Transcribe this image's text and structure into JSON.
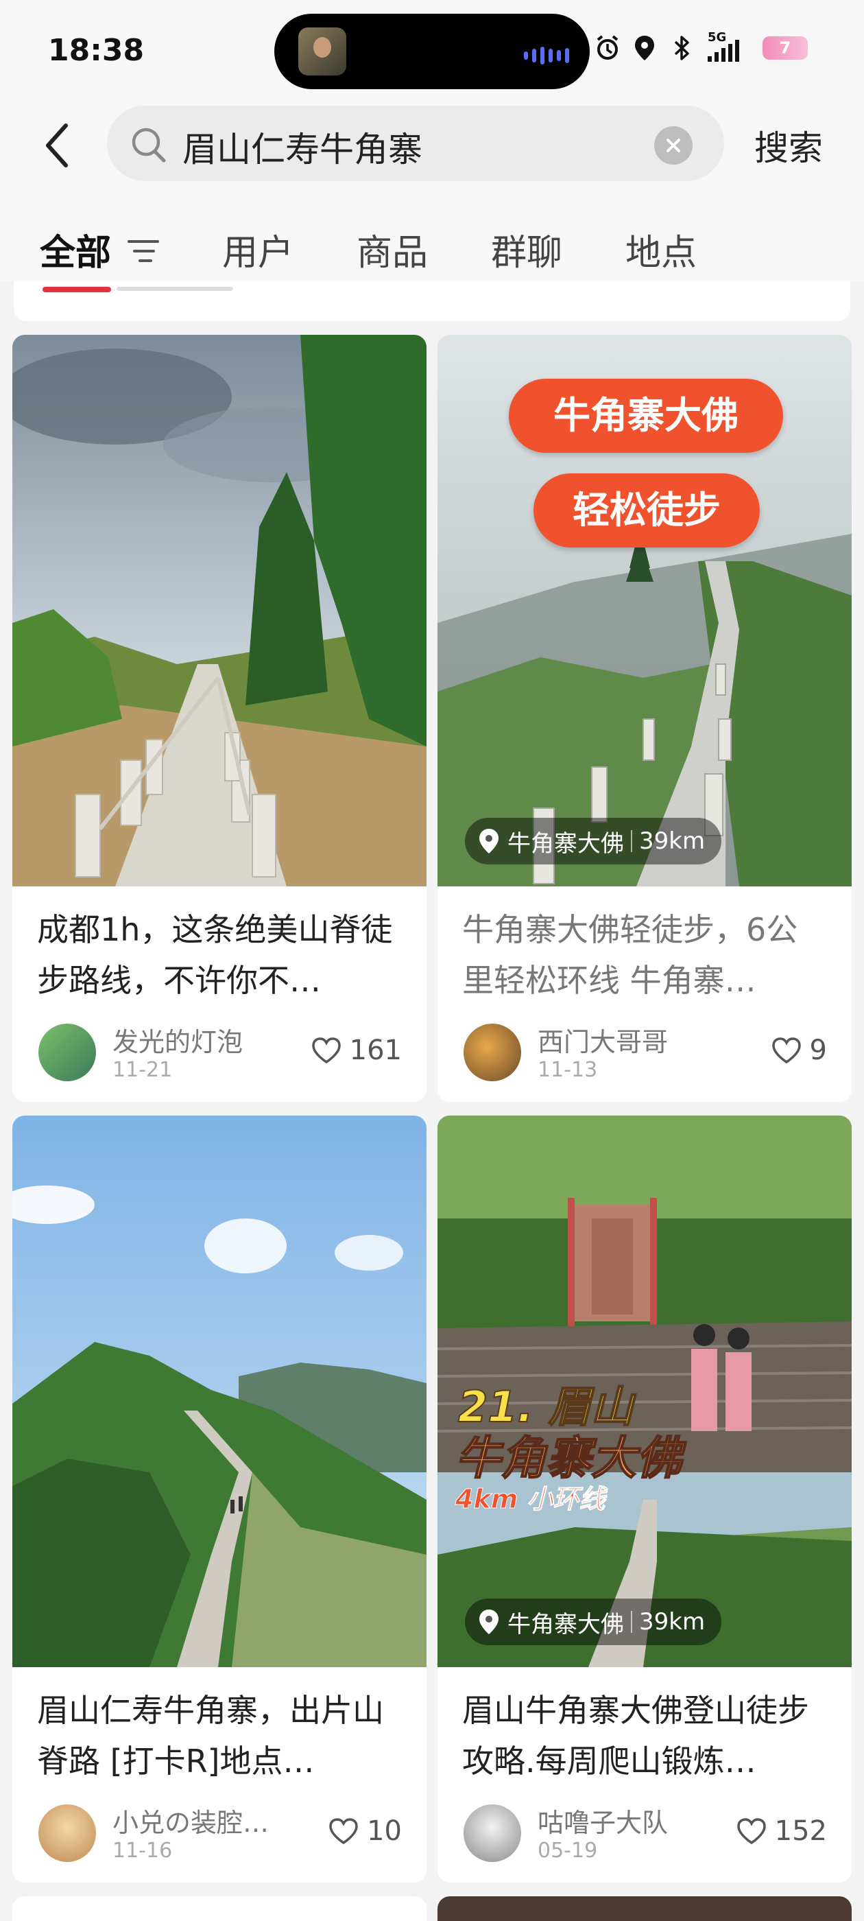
{
  "status_bar": {
    "time": "18:38",
    "network": "5G",
    "battery": "7"
  },
  "search": {
    "query": "眉山仁寿牛角寨",
    "button": "搜索"
  },
  "tabs": [
    "全部",
    "用户",
    "商品",
    "群聊",
    "地点"
  ],
  "cards": [
    {
      "title": "成都1h，这条绝美山脊徒步路线，不许你不…",
      "author": "发光的灯泡",
      "date": "11-21",
      "likes": "161",
      "location": "",
      "distance": "",
      "overlay": []
    },
    {
      "title": "牛角寨大佛轻徒步，6公里轻松环线 牛角寨…",
      "author": "西门大哥哥",
      "date": "11-13",
      "likes": "9",
      "location": "牛角寨大佛",
      "distance": "39km",
      "overlay": [
        "牛角寨大佛",
        "轻松徒步"
      ]
    },
    {
      "title": "眉山仁寿牛角寨，出片山脊路 [打卡R]地点…",
      "author": "小兑の装腔…",
      "date": "11-16",
      "likes": "10",
      "location": "",
      "distance": "",
      "overlay": []
    },
    {
      "title": "眉山牛角寨大佛登山徒步攻略.每周爬山锻炼…",
      "author": "咕噜子大队",
      "date": "05-19",
      "likes": "152",
      "location": "牛角寨大佛",
      "distance": "39km",
      "overlay": [
        "21. 眉山",
        "牛角寨大佛",
        "4km 小环线"
      ]
    }
  ],
  "colors": {
    "accent": "#e5303f",
    "bubble": "#f0522d",
    "overlay_yellow": "#f7e14a",
    "overlay_orange": "#f5a35a"
  }
}
